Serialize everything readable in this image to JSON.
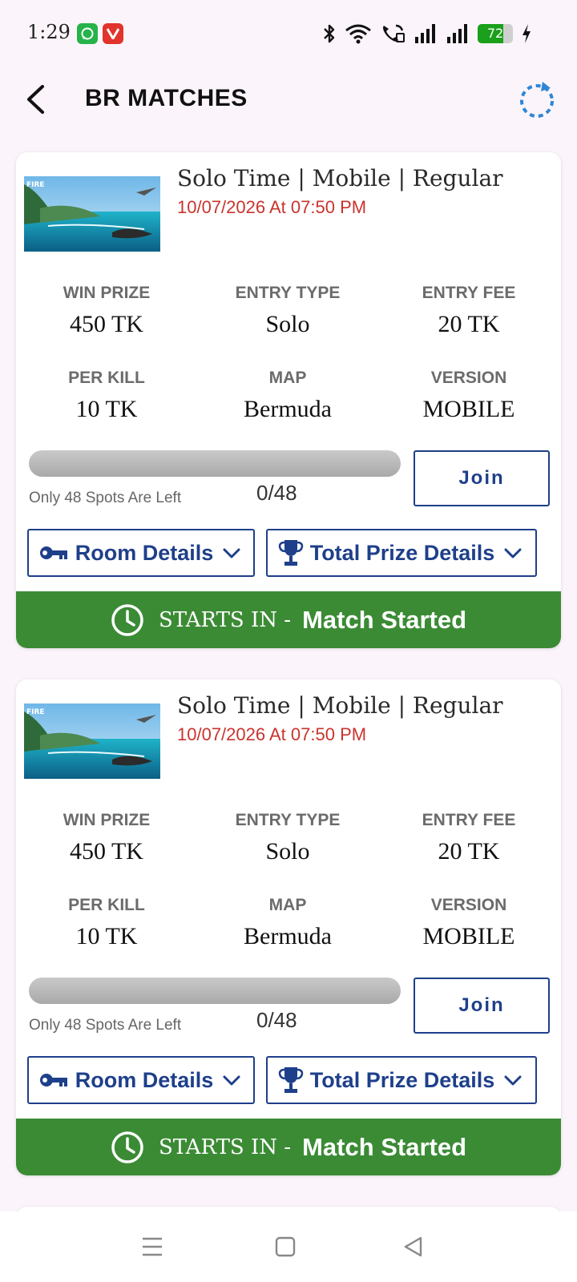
{
  "status_bar": {
    "time": "1:29",
    "apps": [
      "whatsapp-icon",
      "vivaldi-icon"
    ],
    "battery_level": "72",
    "battery_percent": 72,
    "icons": [
      "bluetooth-icon",
      "wifi-icon",
      "wifi-call-icon",
      "signal-icon",
      "signal-icon",
      "battery-icon",
      "charging-icon"
    ]
  },
  "app_bar": {
    "title": "BR MATCHES",
    "back_icon": "back-arrow-icon",
    "refresh_icon": "refresh-icon"
  },
  "colors": {
    "accent_blue": "#1e3f8a",
    "date_red": "#c9342e",
    "status_green": "#3b8b35",
    "label_gray": "#6b6b6b"
  },
  "matches": [
    {
      "title": "Solo Time | Mobile | Regular",
      "datetime": "10/07/2026 At 07:50 PM",
      "win_prize_label": "WIN PRIZE",
      "win_prize": "450 TK",
      "entry_type_label": "ENTRY TYPE",
      "entry_type": "Solo",
      "entry_fee_label": "ENTRY FEE",
      "entry_fee": "20 TK",
      "per_kill_label": "PER KILL",
      "per_kill": "10 TK",
      "map_label": "MAP",
      "map": "Bermuda",
      "version_label": "VERSION",
      "version": "MOBILE",
      "spots_left_text": "Only 48 Spots Are Left",
      "spots_count": "0/48",
      "spots_filled": 0,
      "spots_total": 48,
      "join_label": "Join",
      "room_details_label": "Room Details",
      "prize_details_label": "Total Prize Details",
      "starts_in_label": "STARTS IN -",
      "status": "Match Started"
    },
    {
      "title": "Solo Time | Mobile | Regular",
      "datetime": "10/07/2026 At 07:50 PM",
      "win_prize_label": "WIN PRIZE",
      "win_prize": "450 TK",
      "entry_type_label": "ENTRY TYPE",
      "entry_type": "Solo",
      "entry_fee_label": "ENTRY FEE",
      "entry_fee": "20 TK",
      "per_kill_label": "PER KILL",
      "per_kill": "10 TK",
      "map_label": "MAP",
      "map": "Bermuda",
      "version_label": "VERSION",
      "version": "MOBILE",
      "spots_left_text": "Only 48 Spots Are Left",
      "spots_count": "0/48",
      "spots_filled": 0,
      "spots_total": 48,
      "join_label": "Join",
      "room_details_label": "Room Details",
      "prize_details_label": "Total Prize Details",
      "starts_in_label": "STARTS IN -",
      "status": "Match Started"
    }
  ],
  "nav_bar": {
    "icons": [
      "menu-icon",
      "home-square-icon",
      "back-triangle-icon"
    ]
  }
}
